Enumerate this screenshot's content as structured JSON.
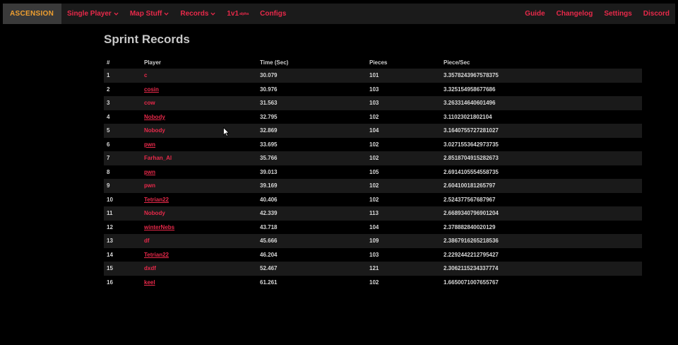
{
  "nav": {
    "brand": "ASCENSION",
    "left": [
      {
        "label": "Single Player",
        "dropdown": true
      },
      {
        "label": "Map Stuff",
        "dropdown": true
      },
      {
        "label": "Records",
        "dropdown": true
      },
      {
        "label": "1v1",
        "badge": "alpha",
        "dropdown": false
      },
      {
        "label": "Configs",
        "dropdown": false
      }
    ],
    "right": [
      "Guide",
      "Changelog",
      "Settings",
      "Discord"
    ]
  },
  "page": {
    "title": "Sprint Records"
  },
  "table": {
    "headers": [
      "#",
      "Player",
      "Time (Sec)",
      "Pieces",
      "Piece/Sec"
    ],
    "rows": [
      {
        "rank": "1",
        "player": "c",
        "linked": false,
        "time": "30.079",
        "pieces": "101",
        "pps": "3.3578243967578375"
      },
      {
        "rank": "2",
        "player": "cosin",
        "linked": true,
        "time": "30.976",
        "pieces": "103",
        "pps": "3.325154958677686"
      },
      {
        "rank": "3",
        "player": "cow",
        "linked": false,
        "time": "31.563",
        "pieces": "103",
        "pps": "3.263314640601496"
      },
      {
        "rank": "4",
        "player": "Nobody",
        "linked": true,
        "time": "32.795",
        "pieces": "102",
        "pps": "3.11023021802104"
      },
      {
        "rank": "5",
        "player": "Nobody",
        "linked": false,
        "time": "32.869",
        "pieces": "104",
        "pps": "3.1640755727281027"
      },
      {
        "rank": "6",
        "player": "pwn",
        "linked": true,
        "time": "33.695",
        "pieces": "102",
        "pps": "3.0271553642973735"
      },
      {
        "rank": "7",
        "player": "Farhan_Al",
        "linked": false,
        "time": "35.766",
        "pieces": "102",
        "pps": "2.8518704915282673"
      },
      {
        "rank": "8",
        "player": "pwn",
        "linked": true,
        "time": "39.013",
        "pieces": "105",
        "pps": "2.6914105554558735"
      },
      {
        "rank": "9",
        "player": "pwn",
        "linked": false,
        "time": "39.169",
        "pieces": "102",
        "pps": "2.604100181265797"
      },
      {
        "rank": "10",
        "player": "Tetrian22",
        "linked": true,
        "time": "40.406",
        "pieces": "102",
        "pps": "2.524377567687967"
      },
      {
        "rank": "11",
        "player": "Nobody",
        "linked": false,
        "time": "42.339",
        "pieces": "113",
        "pps": "2.6689340796901204"
      },
      {
        "rank": "12",
        "player": "winterNebs",
        "linked": true,
        "time": "43.718",
        "pieces": "104",
        "pps": "2.378882840020129"
      },
      {
        "rank": "13",
        "player": "df",
        "linked": false,
        "time": "45.666",
        "pieces": "109",
        "pps": "2.3867916265218536"
      },
      {
        "rank": "14",
        "player": "Tetrian22",
        "linked": true,
        "time": "46.204",
        "pieces": "103",
        "pps": "2.2292442212795427"
      },
      {
        "rank": "15",
        "player": "dxdf",
        "linked": false,
        "time": "52.467",
        "pieces": "121",
        "pps": "2.3062115234337774"
      },
      {
        "rank": "16",
        "player": "keel",
        "linked": true,
        "time": "61.261",
        "pieces": "102",
        "pps": "1.6650071007655767"
      }
    ]
  },
  "colors": {
    "accent": "#e8294a",
    "brand": "#f0a030",
    "navbar": "#1b1b1b",
    "row_alt": "#1a1a1a"
  }
}
